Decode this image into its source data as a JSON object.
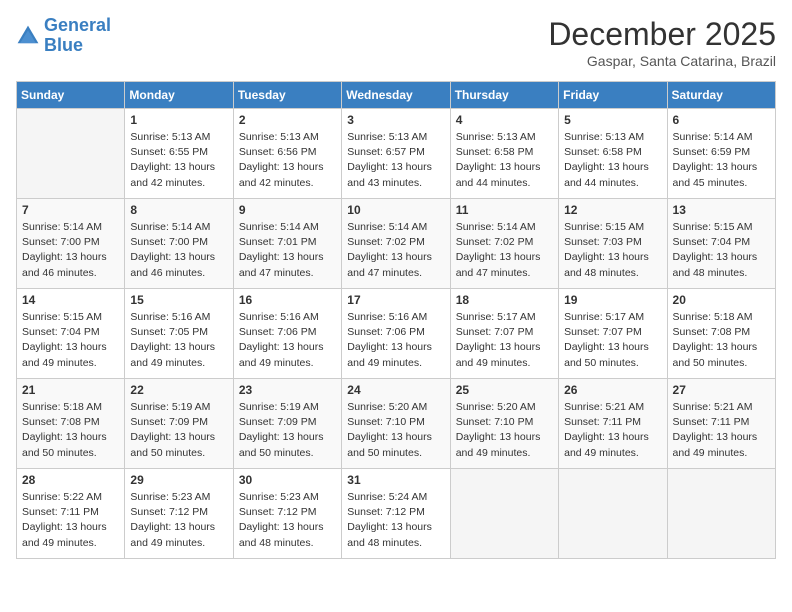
{
  "logo": {
    "line1": "General",
    "line2": "Blue"
  },
  "title": "December 2025",
  "location": "Gaspar, Santa Catarina, Brazil",
  "days_header": [
    "Sunday",
    "Monday",
    "Tuesday",
    "Wednesday",
    "Thursday",
    "Friday",
    "Saturday"
  ],
  "weeks": [
    [
      {
        "num": "",
        "info": ""
      },
      {
        "num": "1",
        "info": "Sunrise: 5:13 AM\nSunset: 6:55 PM\nDaylight: 13 hours\nand 42 minutes."
      },
      {
        "num": "2",
        "info": "Sunrise: 5:13 AM\nSunset: 6:56 PM\nDaylight: 13 hours\nand 42 minutes."
      },
      {
        "num": "3",
        "info": "Sunrise: 5:13 AM\nSunset: 6:57 PM\nDaylight: 13 hours\nand 43 minutes."
      },
      {
        "num": "4",
        "info": "Sunrise: 5:13 AM\nSunset: 6:58 PM\nDaylight: 13 hours\nand 44 minutes."
      },
      {
        "num": "5",
        "info": "Sunrise: 5:13 AM\nSunset: 6:58 PM\nDaylight: 13 hours\nand 44 minutes."
      },
      {
        "num": "6",
        "info": "Sunrise: 5:14 AM\nSunset: 6:59 PM\nDaylight: 13 hours\nand 45 minutes."
      }
    ],
    [
      {
        "num": "7",
        "info": "Sunrise: 5:14 AM\nSunset: 7:00 PM\nDaylight: 13 hours\nand 46 minutes."
      },
      {
        "num": "8",
        "info": "Sunrise: 5:14 AM\nSunset: 7:00 PM\nDaylight: 13 hours\nand 46 minutes."
      },
      {
        "num": "9",
        "info": "Sunrise: 5:14 AM\nSunset: 7:01 PM\nDaylight: 13 hours\nand 47 minutes."
      },
      {
        "num": "10",
        "info": "Sunrise: 5:14 AM\nSunset: 7:02 PM\nDaylight: 13 hours\nand 47 minutes."
      },
      {
        "num": "11",
        "info": "Sunrise: 5:14 AM\nSunset: 7:02 PM\nDaylight: 13 hours\nand 47 minutes."
      },
      {
        "num": "12",
        "info": "Sunrise: 5:15 AM\nSunset: 7:03 PM\nDaylight: 13 hours\nand 48 minutes."
      },
      {
        "num": "13",
        "info": "Sunrise: 5:15 AM\nSunset: 7:04 PM\nDaylight: 13 hours\nand 48 minutes."
      }
    ],
    [
      {
        "num": "14",
        "info": "Sunrise: 5:15 AM\nSunset: 7:04 PM\nDaylight: 13 hours\nand 49 minutes."
      },
      {
        "num": "15",
        "info": "Sunrise: 5:16 AM\nSunset: 7:05 PM\nDaylight: 13 hours\nand 49 minutes."
      },
      {
        "num": "16",
        "info": "Sunrise: 5:16 AM\nSunset: 7:06 PM\nDaylight: 13 hours\nand 49 minutes."
      },
      {
        "num": "17",
        "info": "Sunrise: 5:16 AM\nSunset: 7:06 PM\nDaylight: 13 hours\nand 49 minutes."
      },
      {
        "num": "18",
        "info": "Sunrise: 5:17 AM\nSunset: 7:07 PM\nDaylight: 13 hours\nand 49 minutes."
      },
      {
        "num": "19",
        "info": "Sunrise: 5:17 AM\nSunset: 7:07 PM\nDaylight: 13 hours\nand 50 minutes."
      },
      {
        "num": "20",
        "info": "Sunrise: 5:18 AM\nSunset: 7:08 PM\nDaylight: 13 hours\nand 50 minutes."
      }
    ],
    [
      {
        "num": "21",
        "info": "Sunrise: 5:18 AM\nSunset: 7:08 PM\nDaylight: 13 hours\nand 50 minutes."
      },
      {
        "num": "22",
        "info": "Sunrise: 5:19 AM\nSunset: 7:09 PM\nDaylight: 13 hours\nand 50 minutes."
      },
      {
        "num": "23",
        "info": "Sunrise: 5:19 AM\nSunset: 7:09 PM\nDaylight: 13 hours\nand 50 minutes."
      },
      {
        "num": "24",
        "info": "Sunrise: 5:20 AM\nSunset: 7:10 PM\nDaylight: 13 hours\nand 50 minutes."
      },
      {
        "num": "25",
        "info": "Sunrise: 5:20 AM\nSunset: 7:10 PM\nDaylight: 13 hours\nand 49 minutes."
      },
      {
        "num": "26",
        "info": "Sunrise: 5:21 AM\nSunset: 7:11 PM\nDaylight: 13 hours\nand 49 minutes."
      },
      {
        "num": "27",
        "info": "Sunrise: 5:21 AM\nSunset: 7:11 PM\nDaylight: 13 hours\nand 49 minutes."
      }
    ],
    [
      {
        "num": "28",
        "info": "Sunrise: 5:22 AM\nSunset: 7:11 PM\nDaylight: 13 hours\nand 49 minutes."
      },
      {
        "num": "29",
        "info": "Sunrise: 5:23 AM\nSunset: 7:12 PM\nDaylight: 13 hours\nand 49 minutes."
      },
      {
        "num": "30",
        "info": "Sunrise: 5:23 AM\nSunset: 7:12 PM\nDaylight: 13 hours\nand 48 minutes."
      },
      {
        "num": "31",
        "info": "Sunrise: 5:24 AM\nSunset: 7:12 PM\nDaylight: 13 hours\nand 48 minutes."
      },
      {
        "num": "",
        "info": ""
      },
      {
        "num": "",
        "info": ""
      },
      {
        "num": "",
        "info": ""
      }
    ]
  ]
}
